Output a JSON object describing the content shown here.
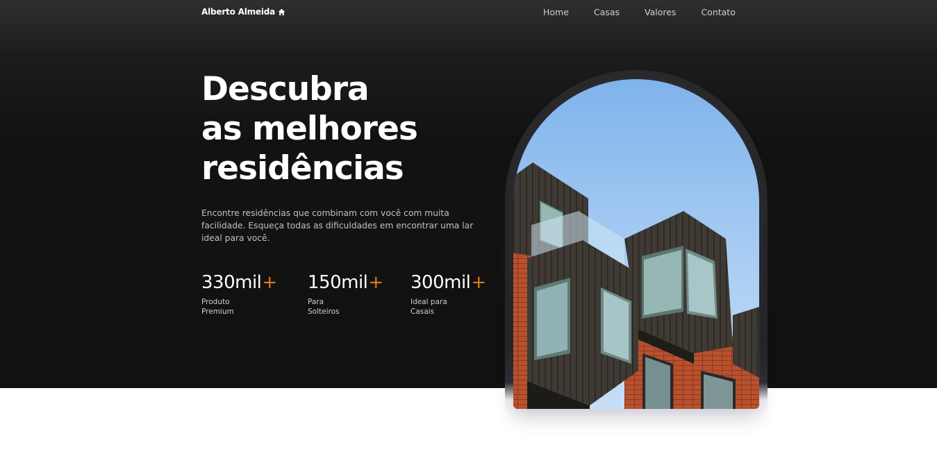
{
  "nav": {
    "logo_text": "Alberto Almeida",
    "logo_icon": "home-icon",
    "links": [
      {
        "label": "Home"
      },
      {
        "label": "Casas"
      },
      {
        "label": "Valores"
      },
      {
        "label": "Contato"
      }
    ]
  },
  "hero": {
    "headline_lines": [
      "Descubra",
      "as melhores",
      "residências"
    ],
    "subtitle": "Encontre residências que combinam com você com muita facilidade. Esqueça todas as dificuldades em encontrar uma lar ideal para você.",
    "stats": [
      {
        "value": "330mil",
        "plus": "+",
        "label_lines": [
          "Produto",
          "Premium"
        ]
      },
      {
        "value": "150mil",
        "plus": "+",
        "label_lines": [
          "Para",
          "Solteiros"
        ]
      },
      {
        "value": "300mil",
        "plus": "+",
        "label_lines": [
          "Ideal para",
          "Casais"
        ]
      }
    ]
  },
  "colors": {
    "hero_background": "#111111",
    "accent": "#e07a1c",
    "text_primary": "#ffffff",
    "text_muted": "#c2c2c2"
  }
}
